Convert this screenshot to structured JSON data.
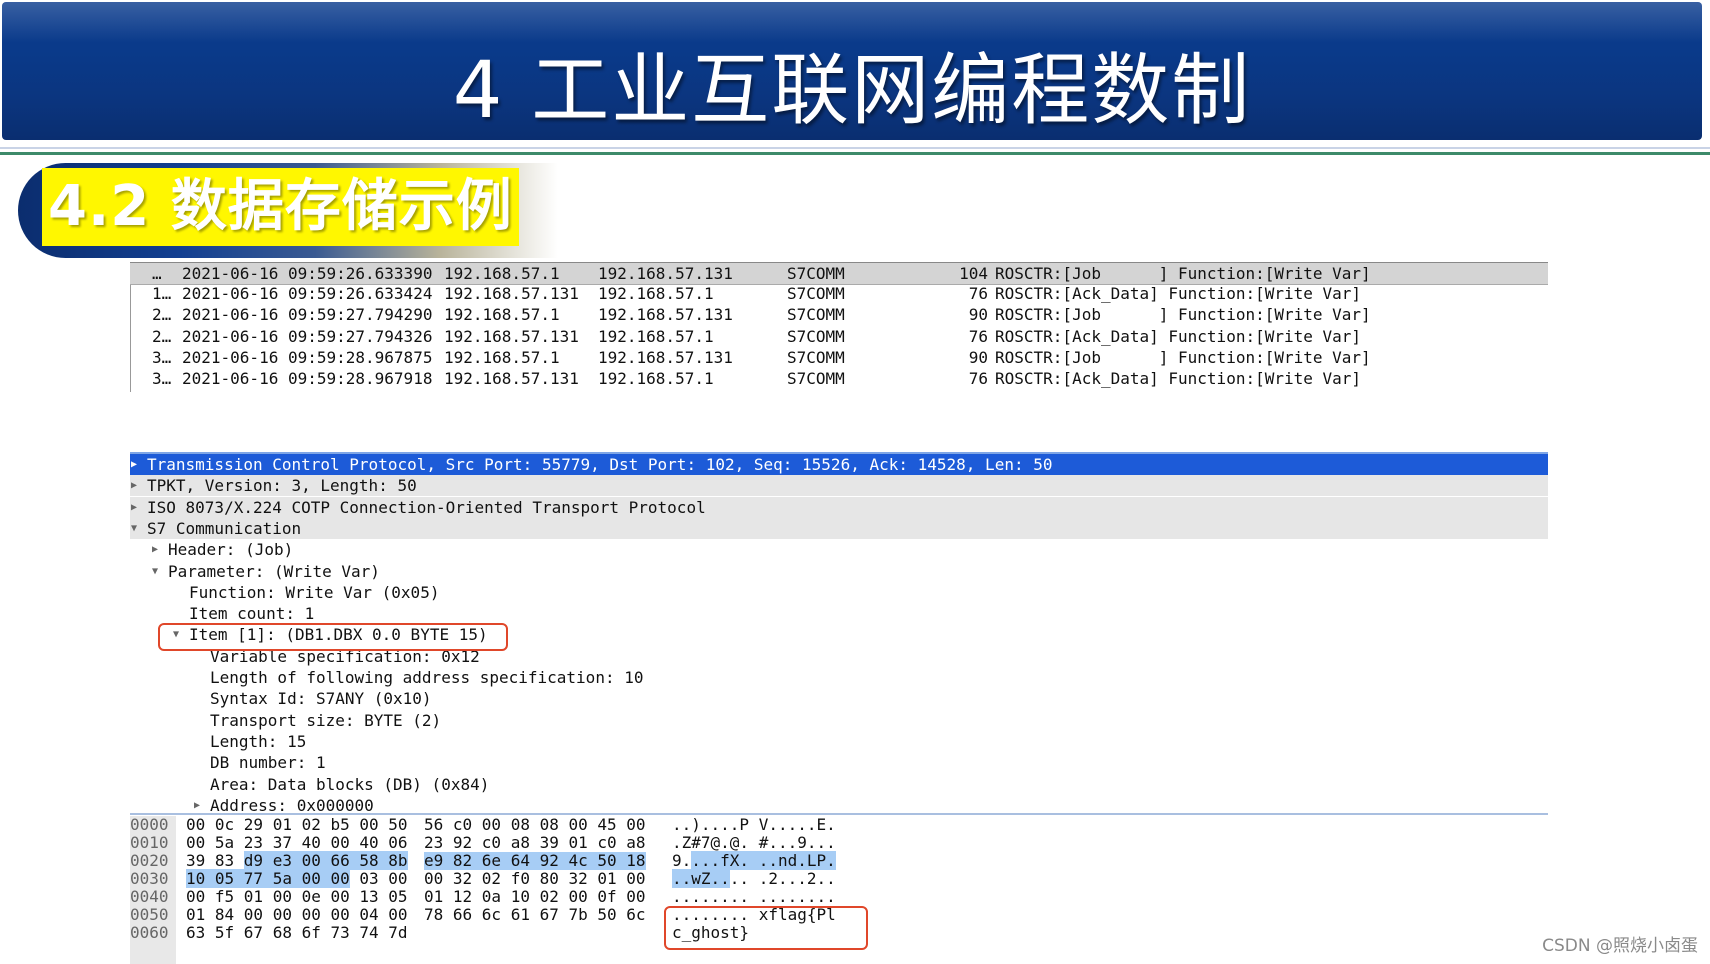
{
  "banner": {
    "title": "4 工业互联网编程数制"
  },
  "section": {
    "label": "4.2 数据存储示例"
  },
  "packets": [
    {
      "no": "…",
      "time": "2021-06-16 09:59:26.633390",
      "src": "192.168.57.1",
      "dst": "192.168.57.131",
      "proto": "S7COMM",
      "len": "104",
      "info": "ROSCTR:[Job      ] Function:[Write Var]"
    },
    {
      "no": "1…",
      "time": "2021-06-16 09:59:26.633424",
      "src": "192.168.57.131",
      "dst": "192.168.57.1",
      "proto": "S7COMM",
      "len": "76",
      "info": "ROSCTR:[Ack_Data] Function:[Write Var]"
    },
    {
      "no": "2…",
      "time": "2021-06-16 09:59:27.794290",
      "src": "192.168.57.1",
      "dst": "192.168.57.131",
      "proto": "S7COMM",
      "len": "90",
      "info": "ROSCTR:[Job      ] Function:[Write Var]"
    },
    {
      "no": "2…",
      "time": "2021-06-16 09:59:27.794326",
      "src": "192.168.57.131",
      "dst": "192.168.57.1",
      "proto": "S7COMM",
      "len": "76",
      "info": "ROSCTR:[Ack_Data] Function:[Write Var]"
    },
    {
      "no": "3…",
      "time": "2021-06-16 09:59:28.967875",
      "src": "192.168.57.1",
      "dst": "192.168.57.131",
      "proto": "S7COMM",
      "len": "90",
      "info": "ROSCTR:[Job      ] Function:[Write Var]"
    },
    {
      "no": "3…",
      "time": "2021-06-16 09:59:28.967918",
      "src": "192.168.57.131",
      "dst": "192.168.57.1",
      "proto": "S7COMM",
      "len": "76",
      "info": "ROSCTR:[Ack_Data] Function:[Write Var]"
    }
  ],
  "details": [
    {
      "text": "Transmission Control Protocol, Src Port: 55779, Dst Port: 102, Seq: 15526, Ack: 14528, Len: 50",
      "arrow": "▶"
    },
    {
      "text": "TPKT, Version: 3, Length: 50",
      "arrow": "▶"
    },
    {
      "text": "ISO 8073/X.224 COTP Connection-Oriented Transport Protocol",
      "arrow": "▶"
    },
    {
      "text": "S7 Communication",
      "arrow": "▼"
    },
    {
      "text": "Header: (Job)",
      "arrow": "▶"
    },
    {
      "text": "Parameter: (Write Var)",
      "arrow": "▼"
    },
    {
      "text": "Function: Write Var (0x05)",
      "arrow": ""
    },
    {
      "text": "Item count: 1",
      "arrow": ""
    },
    {
      "text": "Item [1]: (DB1.DBX 0.0 BYTE 15)",
      "arrow": "▼"
    },
    {
      "text": "Variable specification: 0x12",
      "arrow": ""
    },
    {
      "text": "Length of following address specification: 10",
      "arrow": ""
    },
    {
      "text": "Syntax Id: S7ANY (0x10)",
      "arrow": ""
    },
    {
      "text": "Transport size: BYTE (2)",
      "arrow": ""
    },
    {
      "text": "Length: 15",
      "arrow": ""
    },
    {
      "text": "DB number: 1",
      "arrow": ""
    },
    {
      "text": "Area: Data blocks (DB) (0x84)",
      "arrow": ""
    },
    {
      "text": "Address: 0x000000",
      "arrow": "▶"
    }
  ],
  "hex": [
    {
      "off": "0000",
      "a": "00 0c 29 01 02 b5 00 50",
      "b": "56 c0 00 08 08 00 45 00",
      "c": "..)....P V.....E."
    },
    {
      "off": "0010",
      "a": "00 5a 23 37 40 00 40 06",
      "b": "23 92 c0 a8 39 01 c0 a8",
      "c": ".Z#7@.@. #...9..."
    },
    {
      "off": "0020",
      "a1": "39 83 ",
      "a2": "d9 e3 00 66 58 8b",
      "b": "e9 82 6e 64 92 4c 50 18",
      "c1": "9.",
      "c2": "...fX. ..nd.LP."
    },
    {
      "off": "0030",
      "a1": "10 05 77 5a 00 00",
      "a2": " 03 00",
      "b": "00 32 02 f0 80 32 01 00",
      "c1": "..wZ..",
      "c2": ".. .2...2.."
    },
    {
      "off": "0040",
      "a": "00 f5 01 00 0e 00 13 05",
      "b": "01 12 0a 10 02 00 0f 00",
      "c": "........ ........"
    },
    {
      "off": "0050",
      "a": "01 84 00 00 00 00 04 00",
      "b": "78 66 6c 61 67 7b 50 6c",
      "c": "........ xflag{Pl"
    },
    {
      "off": "0060",
      "a": "63 5f 67 68 6f 73 74 7d",
      "b": "",
      "c": "c_ghost}"
    }
  ],
  "watermark": "CSDN @照烧小卤蛋"
}
